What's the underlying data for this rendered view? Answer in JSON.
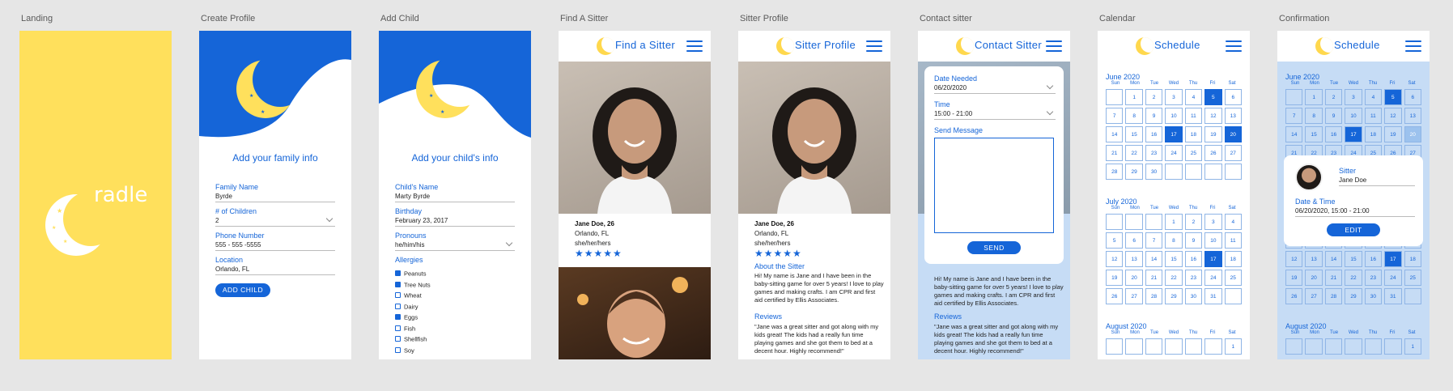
{
  "boards": {
    "landing": "Landing",
    "create_profile": "Create Profile",
    "add_child": "Add Child",
    "find_sitter": "Find A Sitter",
    "sitter_profile": "Sitter Profile",
    "contact_sitter": "Contact sitter",
    "calendar": "Calendar",
    "confirmation": "Confirmation"
  },
  "landing": {
    "logo_text": "radle"
  },
  "create_profile": {
    "heading": "Add your family info",
    "fields": [
      {
        "label": "Family Name",
        "value": "Byrde"
      },
      {
        "label": "# of Children",
        "value": "2"
      },
      {
        "label": "Phone Number",
        "value": "555 - 555 -5555"
      },
      {
        "label": "Location",
        "value": "Orlando, FL"
      }
    ],
    "button": "ADD CHILD"
  },
  "add_child": {
    "heading": "Add your child's info",
    "fields": [
      {
        "label": "Child's Name",
        "value": "Marty Byrde"
      },
      {
        "label": "Birthday",
        "value": "February 23, 2017"
      },
      {
        "label": "Pronouns",
        "value": "he/him/his"
      }
    ],
    "allergies_label": "Allergies",
    "allergies": [
      {
        "name": "Peanuts",
        "checked": true
      },
      {
        "name": "Tree Nuts",
        "checked": true
      },
      {
        "name": "Wheat",
        "checked": false
      },
      {
        "name": "Dairy",
        "checked": false
      },
      {
        "name": "Eggs",
        "checked": true
      },
      {
        "name": "Fish",
        "checked": false
      },
      {
        "name": "Shellfish",
        "checked": false
      },
      {
        "name": "Soy",
        "checked": false
      }
    ]
  },
  "find_sitter": {
    "title": "Find a Sitter",
    "name": "Jane Doe, 26",
    "location": "Orlando, FL",
    "pronouns": "she/her/hers",
    "rating": 5
  },
  "sitter_profile": {
    "title": "Sitter Profile",
    "name": "Jane Doe, 26",
    "location": "Orlando, FL",
    "pronouns": "she/her/hers",
    "about_label": "About the Sitter",
    "about": "Hi! My name is Jane and I have been in the baby-sitting game for over 5 years! I love to play games and making crafts. I am CPR and first aid certified by Ellis Associates.",
    "reviews_label": "Reviews",
    "review": "\"Jane was a great sitter and got along with my kids great! The kids had a really fun time playing games and she got them to bed at a decent hour. Highly recommend!\""
  },
  "contact_sitter": {
    "title": "Contact Sitter",
    "date_label": "Date Needed",
    "date_value": "06/20/2020",
    "time_label": "Time",
    "time_value": "15:00 - 21:00",
    "message_label": "Send Message",
    "send": "SEND",
    "about": "Hi! My name is Jane and I have been in the baby-sitting game for over 5 years! I love to play games and making crafts. I am CPR and first aid certified by Ellis Associates.",
    "reviews_label": "Reviews",
    "review": "\"Jane was a great sitter and got along with my kids great! The kids had a really fun time playing games and she got them to bed at a decent hour. Highly recommend!\""
  },
  "calendar": {
    "title": "Schedule",
    "dow": [
      "Sun",
      "Mon",
      "Tue",
      "Wed",
      "Thu",
      "Fri",
      "Sat"
    ],
    "june": "June 2020",
    "july": "July 2020",
    "august": "August 2020"
  },
  "confirmation": {
    "title": "Schedule",
    "sitter_label": "Sitter",
    "sitter_value": "Jane Doe",
    "datetime_label": "Date & Time",
    "datetime_value": "06/20/2020, 15:00 - 21:00",
    "edit": "EDIT"
  }
}
